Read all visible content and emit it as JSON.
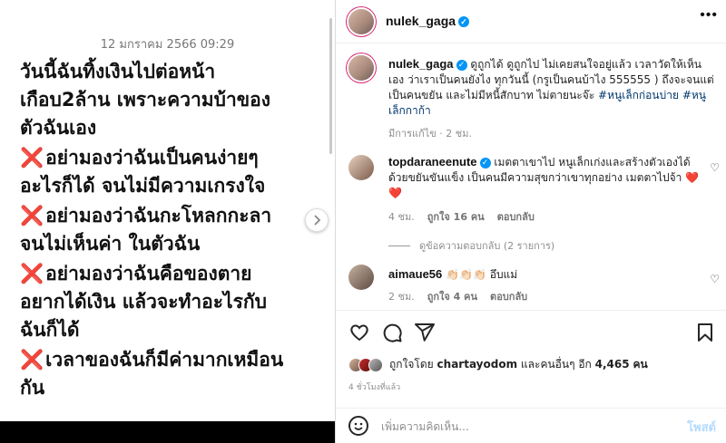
{
  "note": {
    "timestamp": "12 มกราคม 2566 09:29",
    "paragraphs": [
      {
        "mark": false,
        "lines": [
          "วันนี้ฉันทิ้งเงินไปต่อหน้า",
          "เกือบ2ล้าน เพราะความบ้าของ",
          "ตัวฉันเอง"
        ]
      },
      {
        "mark": true,
        "lines": [
          "อย่ามองว่าฉันเป็นคนง่ายๆ",
          "อะไรก็ได้ จนไม่มีความเกรงใจ"
        ]
      },
      {
        "mark": true,
        "lines": [
          "อย่ามองว่าฉันกะโหลกกะลา",
          "จนไม่เห็นค่า ในตัวฉัน"
        ]
      },
      {
        "mark": true,
        "lines": [
          "อย่ามองว่าฉันคือของตาย",
          "อยากได้เงิน แล้วจะทำอะไรกับ",
          "ฉันก็ได้"
        ]
      },
      {
        "mark": true,
        "lines": [
          "เวลาของฉันก็มีค่ามากเหมือน",
          "กัน"
        ]
      }
    ],
    "mark_glyph": "❌"
  },
  "header": {
    "username": "nulek_gaga"
  },
  "caption": {
    "username": "nulek_gaga",
    "text": "ดูถูกได้ ดูถูกไป ไม่เคยสนใจอยู่แล้ว เวลาวัดให้เห็นเอง ว่าเราเป็นคนยังไง ทุกวันนี้ (กรูเป็นคนบ้าไง 555555 ) ถึงจะจนแต่เป็นคนขยัน และไม่มีหนี้สักบาท ไม่ตายนะจ๊ะ ",
    "hashtag1": "#หนูเล็กก่อนบ่าย",
    "hashtag2": "#หนูเล็กกาก้า",
    "edited": "มีการแก้ไข · 2 ชม."
  },
  "comments": [
    {
      "username": "topdaraneenute",
      "text": "เมตตาเขาไป หนูเล็กเก่งและสร้างตัวเองได้ด้วยขยันขันแข็ง เป็นคนมีความสุขกว่าเขาทุกอย่าง เมตตาไปจ้า",
      "hearts": "❤️ ❤️",
      "time": "4 ชม.",
      "likes": "ถูกใจ 16 คน",
      "reply": "ตอบกลับ",
      "view_replies": "ดูข้อความตอบกลับ (2 รายการ)"
    },
    {
      "username": "aimaue56",
      "text": "👏🏻👏🏻👏🏻 อึบแม่",
      "time": "2 ชม.",
      "likes": "ถูกใจ 4 คน",
      "reply": "ตอบกลับ"
    }
  ],
  "likes": {
    "prefix": "ถูกใจโดย",
    "user": "chartayodom",
    "suffix": "และคนอื่นๆ อีก",
    "count": "4,465",
    "unit": "คน"
  },
  "time_ago": "4 ชั่วโมงที่แล้ว",
  "comment_box": {
    "placeholder": "เพิ่มความคิดเห็น...",
    "post": "โพสต์"
  }
}
